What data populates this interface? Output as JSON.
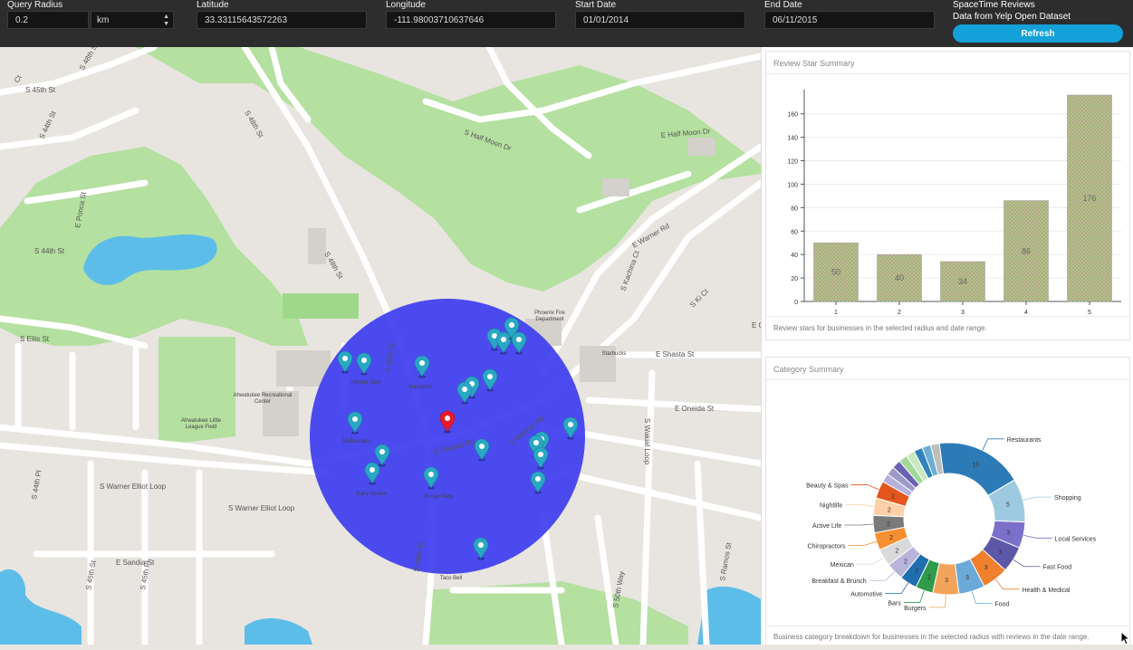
{
  "toolbar": {
    "query_radius_label": "Query Radius",
    "query_radius_value": "0.2",
    "unit_value": "km",
    "latitude_label": "Latitude",
    "latitude_value": "33.33115643572263",
    "longitude_label": "Longitude",
    "longitude_value": "-111.98003710637646",
    "start_date_label": "Start Date",
    "start_date_value": "01/01/2014",
    "end_date_label": "End Date",
    "end_date_value": "06/11/2015",
    "app_title": "SpaceTime Reviews",
    "app_subtitle": "Data from Yelp Open Dataset",
    "refresh_label": "Refresh"
  },
  "map": {
    "road_labels": [
      "S 48th St",
      "S 45th St",
      "S 44th St",
      "E Ponca St",
      "S 44th St",
      "S 48th St",
      "S 48th St",
      "S Half Moon Dr",
      "E Half Moon Dr",
      "E Warner Rd",
      "E Warner Rd",
      "E Warner Rd",
      "S Warner Elliot Loop",
      "S Warner Elliot Loop",
      "E Shasta St",
      "E Oneida St",
      "S Wakial Loop",
      "S 48th St",
      "S 48th St",
      "E Sandia St",
      "S 45th St",
      "S 45th Pl",
      "S 50th Way",
      "S Kachina Ct",
      "E Ct",
      "S Ki Ct",
      "S Ramos St",
      "S Ellis St",
      "S 44th Pl",
      "Ct"
    ],
    "poi_labels": [
      "Phoenix Fire Department",
      "Starbucks",
      "Ahwatukee Recreational Center",
      "Ahwatukee Little League Field",
      "Hillside Spot",
      "Macayo's",
      "McDonald's",
      "Dairy Queen",
      "Burger King",
      "Taco Bell"
    ],
    "circle_color": "#3d3df0",
    "marker_color": "#29a8c4",
    "center_marker_color": "#e8192c"
  },
  "stars_card": {
    "title": "Review Star Summary",
    "caption": "Review stars for businesses in the selected radius and date range.",
    "chart_data": {
      "type": "bar",
      "title": "",
      "xlabel": "",
      "ylabel": "",
      "categories": [
        "1",
        "2",
        "3",
        "4",
        "5"
      ],
      "values": [
        50,
        40,
        34,
        86,
        176
      ],
      "ylim": [
        0,
        176
      ],
      "yticks": [
        "0",
        "20",
        "40",
        "60",
        "80",
        "100",
        "120",
        "140",
        "160"
      ],
      "grid": true,
      "legend": "none",
      "bar_color": "#b5c28a"
    }
  },
  "category_card": {
    "title": "Category Summary",
    "caption": "Business category breakdown for businesses in the selected radius with reviews in the date range.",
    "chart_data": {
      "type": "pie",
      "donut": true,
      "slices": [
        {
          "name": "Restaurants",
          "value": 10,
          "color": "#2c7bb6"
        },
        {
          "name": "Shopping",
          "value": 5,
          "color": "#9ecae1"
        },
        {
          "name": "Local Services",
          "value": 3,
          "color": "#7b6fc9"
        },
        {
          "name": "Fast Food",
          "value": 3,
          "color": "#5d57a8"
        },
        {
          "name": "Health & Medical",
          "value": 3,
          "color": "#f0802c"
        },
        {
          "name": "Food",
          "value": 3,
          "color": "#6aa9d8"
        },
        {
          "name": "Burgers",
          "value": 3,
          "color": "#f4a45a"
        },
        {
          "name": "Bars",
          "value": 2,
          "color": "#2e9a4a"
        },
        {
          "name": "Automotive",
          "value": 2,
          "color": "#1f6fb0"
        },
        {
          "name": "Breakfast & Brunch",
          "value": 2,
          "color": "#b8b4dc"
        },
        {
          "name": "Mexican",
          "value": 2,
          "color": "#d9d9d9"
        },
        {
          "name": "Chiropractors",
          "value": 2,
          "color": "#f58f30"
        },
        {
          "name": "Active Life",
          "value": 2,
          "color": "#7a7a7a"
        },
        {
          "name": "Nightlife",
          "value": 2,
          "color": "#fdd0a8"
        },
        {
          "name": "Beauty & Spas",
          "value": 2,
          "color": "#e4561b"
        },
        {
          "name": "",
          "value": 1,
          "color": "#b7b0dd"
        },
        {
          "name": "",
          "value": 1,
          "color": "#9e9ac8"
        },
        {
          "name": "",
          "value": 1,
          "color": "#6a63b2"
        },
        {
          "name": "",
          "value": 1,
          "color": "#a1d99b"
        },
        {
          "name": "",
          "value": 1,
          "color": "#c7e9c0"
        },
        {
          "name": "",
          "value": 1,
          "color": "#3182bd"
        },
        {
          "name": "",
          "value": 1,
          "color": "#6baed6"
        },
        {
          "name": "",
          "value": 1,
          "color": "#bdbdbd"
        }
      ]
    }
  }
}
